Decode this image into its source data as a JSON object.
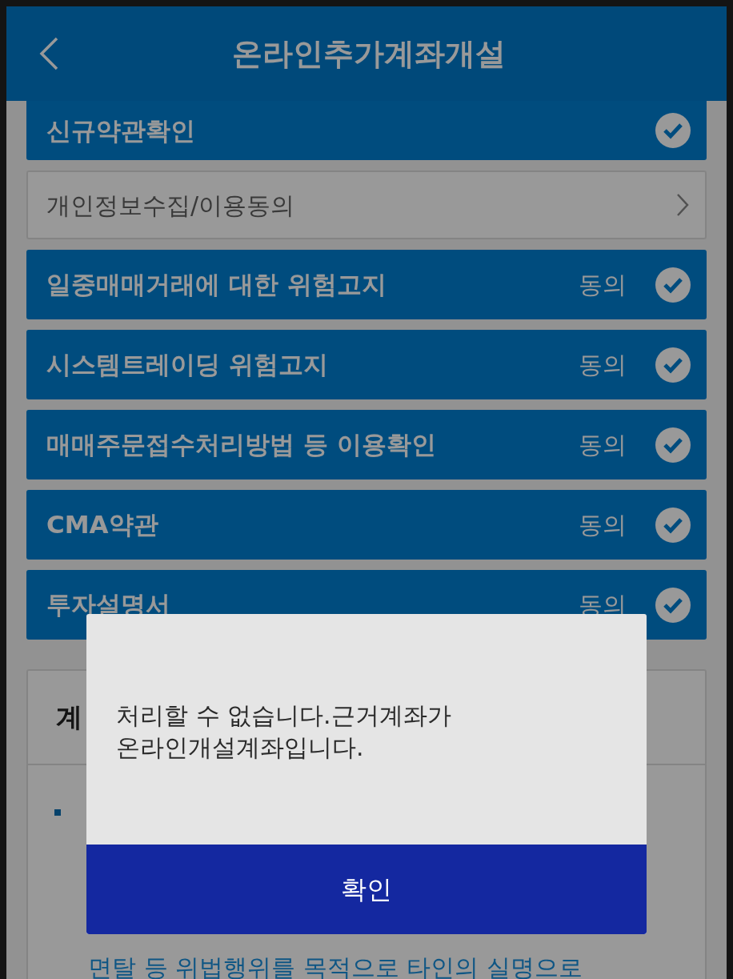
{
  "header": {
    "title": "온라인추가계좌개설"
  },
  "items": [
    {
      "kind": "check",
      "label": "신규약관확인",
      "checked": true
    },
    {
      "kind": "link",
      "label": "개인정보수집/이용동의"
    },
    {
      "kind": "check",
      "label": "일중매매거래에 대한 위험고지",
      "agree": "동의",
      "checked": true
    },
    {
      "kind": "check",
      "label": "시스템트레이딩 위험고지",
      "agree": "동의",
      "checked": true
    },
    {
      "kind": "check",
      "label": "매매주문접수처리방법 등 이용확인",
      "agree": "동의",
      "checked": true
    },
    {
      "kind": "check",
      "label": "CMA약관",
      "agree": "동의",
      "checked": true
    },
    {
      "kind": "check",
      "label": "투자설명서",
      "agree": "동의",
      "checked": true
    }
  ],
  "section": {
    "heading": "계",
    "lines": [
      "면탈 등 위법행위를 목적으로 타인의 실명으로"
    ]
  },
  "dialog": {
    "message": "처리할 수 없습니다.근거계좌가\n온라인개설계좌입니다.",
    "button": "확인"
  }
}
